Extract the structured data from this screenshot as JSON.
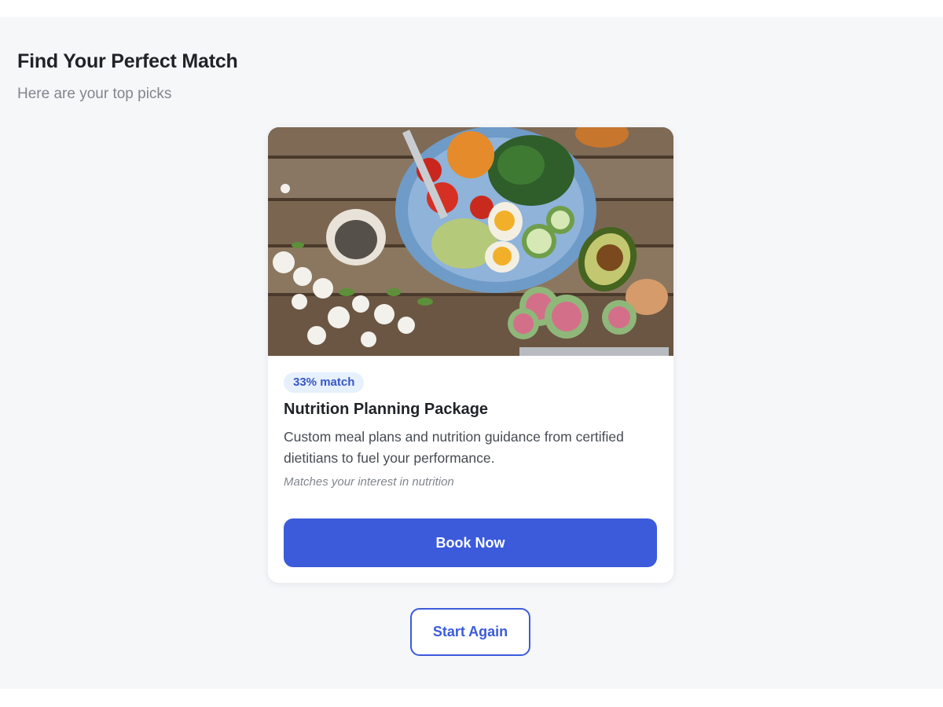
{
  "header": {
    "title": "Find Your Perfect Match",
    "subtitle": "Here are your top picks"
  },
  "recommendation": {
    "image": "healthy-salad-bowl-photo",
    "match_badge": "33% match",
    "title": "Nutrition Planning Package",
    "description": "Custom meal plans and nutrition guidance from certified dietitians to fuel your performance.",
    "reason": "Matches your interest in nutrition",
    "book_label": "Book Now"
  },
  "actions": {
    "start_again_label": "Start Again"
  },
  "colors": {
    "accent": "#3b5bdb",
    "badge_bg": "#e7f0fd",
    "page_bg": "#f6f7f9"
  }
}
